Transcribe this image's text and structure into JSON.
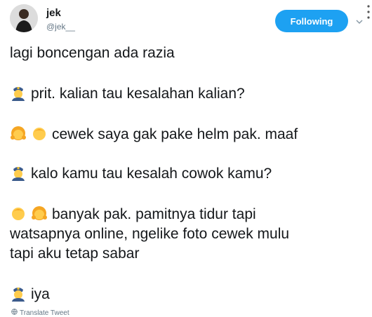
{
  "user": {
    "name": "jek",
    "handle": "@jek__",
    "follow_label": "Following"
  },
  "tweet": {
    "lines": [
      "lagi boncengan ada razia",
      "prit. kalian tau kesalahan kalian?",
      "cewek saya gak pake helm pak. maaf",
      "kalo kamu tau kesalah cowok kamu?",
      "banyak pak. pamitnya tidur tapi",
      "watsapnya online, ngelike foto cewek mulu",
      "tapi aku tetap sabar",
      "iya"
    ],
    "emojis": [
      "police-officer",
      "girl",
      "boy"
    ]
  },
  "footer": {
    "translate_label": "Translate Tweet"
  },
  "colors": {
    "accent": "#1da1f2",
    "text": "#14171a",
    "muted": "#657786"
  }
}
